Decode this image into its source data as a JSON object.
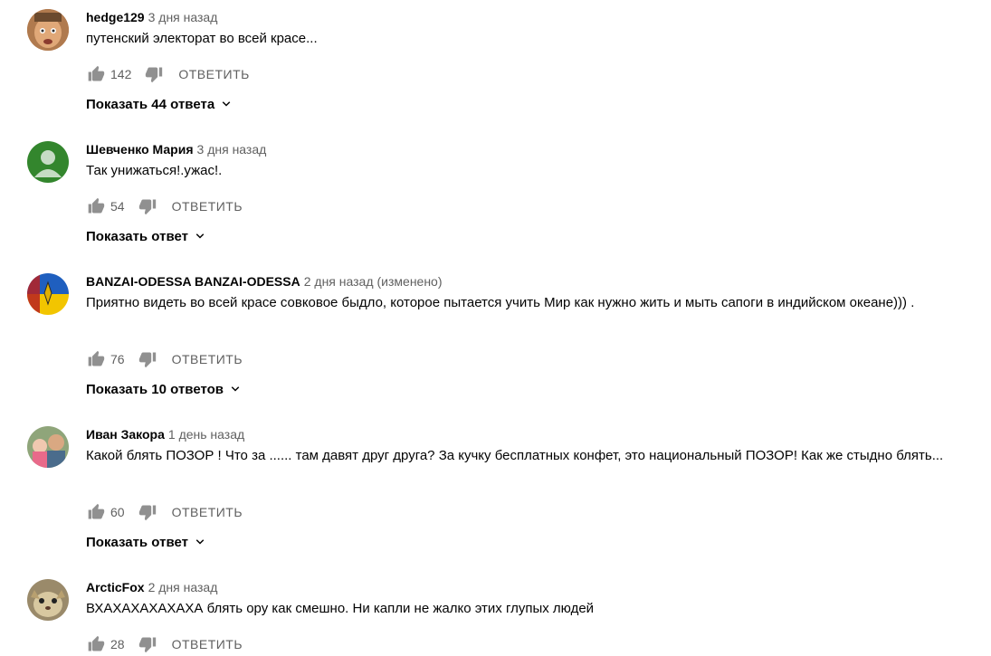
{
  "comments": [
    {
      "author": "hedge129",
      "time": "3 дня назад",
      "edited": "",
      "text": "путенский электорат во всей красе...",
      "likes": "142",
      "reply_label": "ОТВЕТИТЬ",
      "replies_label": "Показать 44 ответа"
    },
    {
      "author": "Шевченко Мария",
      "time": "3 дня назад",
      "edited": "",
      "text": "Так унижаться!.ужас!.",
      "likes": "54",
      "reply_label": "ОТВЕТИТЬ",
      "replies_label": "Показать ответ"
    },
    {
      "author": "BANZAI-ODESSA BANZAI-ODESSA",
      "time": "2 дня назад",
      "edited": "(изменено)",
      "text": "Приятно видеть во всей красе совковое быдло, которое пытается учить Мир как нужно жить и мыть сапоги в индийском океане))) .",
      "likes": "76",
      "reply_label": "ОТВЕТИТЬ",
      "replies_label": "Показать 10 ответов"
    },
    {
      "author": "Иван Закора",
      "time": "1 день назад",
      "edited": "",
      "text": "Какой блять ПОЗОР ! Что за ...... там давят друг друга?  За кучку бесплатных конфет, это национальный ПОЗОР! Как же стыдно блять...",
      "likes": "60",
      "reply_label": "ОТВЕТИТЬ",
      "replies_label": "Показать ответ"
    },
    {
      "author": "ArcticFox",
      "time": "2 дня назад",
      "edited": "",
      "text": "ВХАХАХАХАХАХА блять ору как смешно. Ни капли не жалко этих глупых людей",
      "likes": "28",
      "reply_label": "ОТВЕТИТЬ",
      "replies_label": ""
    }
  ]
}
